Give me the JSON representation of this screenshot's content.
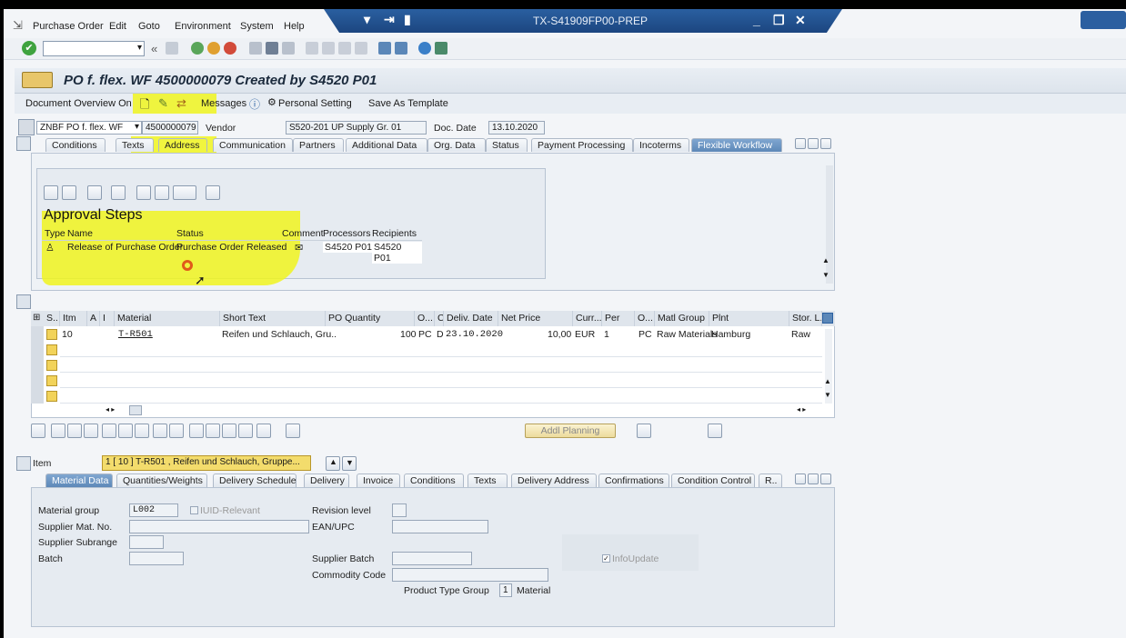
{
  "window": {
    "title": "TX-S41909FP00-PREP"
  },
  "menu": [
    "Purchase Order",
    "Edit",
    "Goto",
    "Environment",
    "System",
    "Help"
  ],
  "page_title": "PO f. flex. WF 4500000079 Created by S4520 P01",
  "appbar": {
    "doc_overview": "Document Overview On",
    "messages": "Messages",
    "personal_setting": "Personal Setting",
    "save_template": "Save As Template"
  },
  "header": {
    "doc_type": "ZNBF PO f. flex. WF",
    "po_number": "4500000079",
    "vendor_label": "Vendor",
    "vendor_value": "S520-201 UP Supply Gr. 01",
    "doc_date_label": "Doc. Date",
    "doc_date_value": "13.10.2020"
  },
  "header_tabs": [
    "Conditions",
    "Texts",
    "Address",
    "Communication",
    "Partners",
    "Additional Data",
    "Org. Data",
    "Status",
    "Payment Processing",
    "Incoterms",
    "Flexible Workflow"
  ],
  "approval": {
    "title": "Approval Steps",
    "columns": [
      "Type",
      "Name",
      "Status",
      "Comment",
      "Processors",
      "Recipients"
    ],
    "row": {
      "name": "Release of Purchase Order",
      "status": "Purchase Order Released",
      "processors": "S4520 P01",
      "recipients": "S4520 P01"
    }
  },
  "items": {
    "columns": [
      "S..",
      "Itm",
      "A",
      "I",
      "Material",
      "Short Text",
      "PO Quantity",
      "O...",
      "C",
      "Deliv. Date",
      "Net Price",
      "Curr...",
      "Per",
      "O...",
      "Matl Group",
      "Plnt",
      "Stor. L."
    ],
    "row": {
      "itm": "10",
      "material": "T-R501",
      "short_text": "Reifen und Schlauch, Gru..",
      "qty": "100",
      "unit": "PC",
      "c": "D",
      "deliv_date": "23.10.2020",
      "net_price": "10,00",
      "curr": "EUR",
      "per": "1",
      "ounit": "PC",
      "matl_group": "Raw Materials",
      "plant": "Hamburg",
      "stor": "Raw ma"
    },
    "addl_planning": "Addl Planning"
  },
  "item_detail": {
    "label": "Item",
    "selector": "1 [ 10 ] T-R501 , Reifen und Schlauch, Gruppe...",
    "tabs": [
      "Material Data",
      "Quantities/Weights",
      "Delivery Schedule",
      "Delivery",
      "Invoice",
      "Conditions",
      "Texts",
      "Delivery Address",
      "Confirmations",
      "Condition Control",
      "R.."
    ],
    "fields": {
      "material_group_label": "Material group",
      "material_group_value": "L002",
      "iuid_label": "IUID-Relevant",
      "revision_label": "Revision level",
      "supplier_mat_label": "Supplier Mat. No.",
      "ean_label": "EAN/UPC",
      "supplier_subrange_label": "Supplier Subrange",
      "batch_label": "Batch",
      "supplier_batch_label": "Supplier Batch",
      "commodity_label": "Commodity Code",
      "product_type_label": "Product Type Group",
      "product_type_value": "1",
      "product_type_text": "Material",
      "infoupdate_label": "InfoUpdate"
    }
  }
}
